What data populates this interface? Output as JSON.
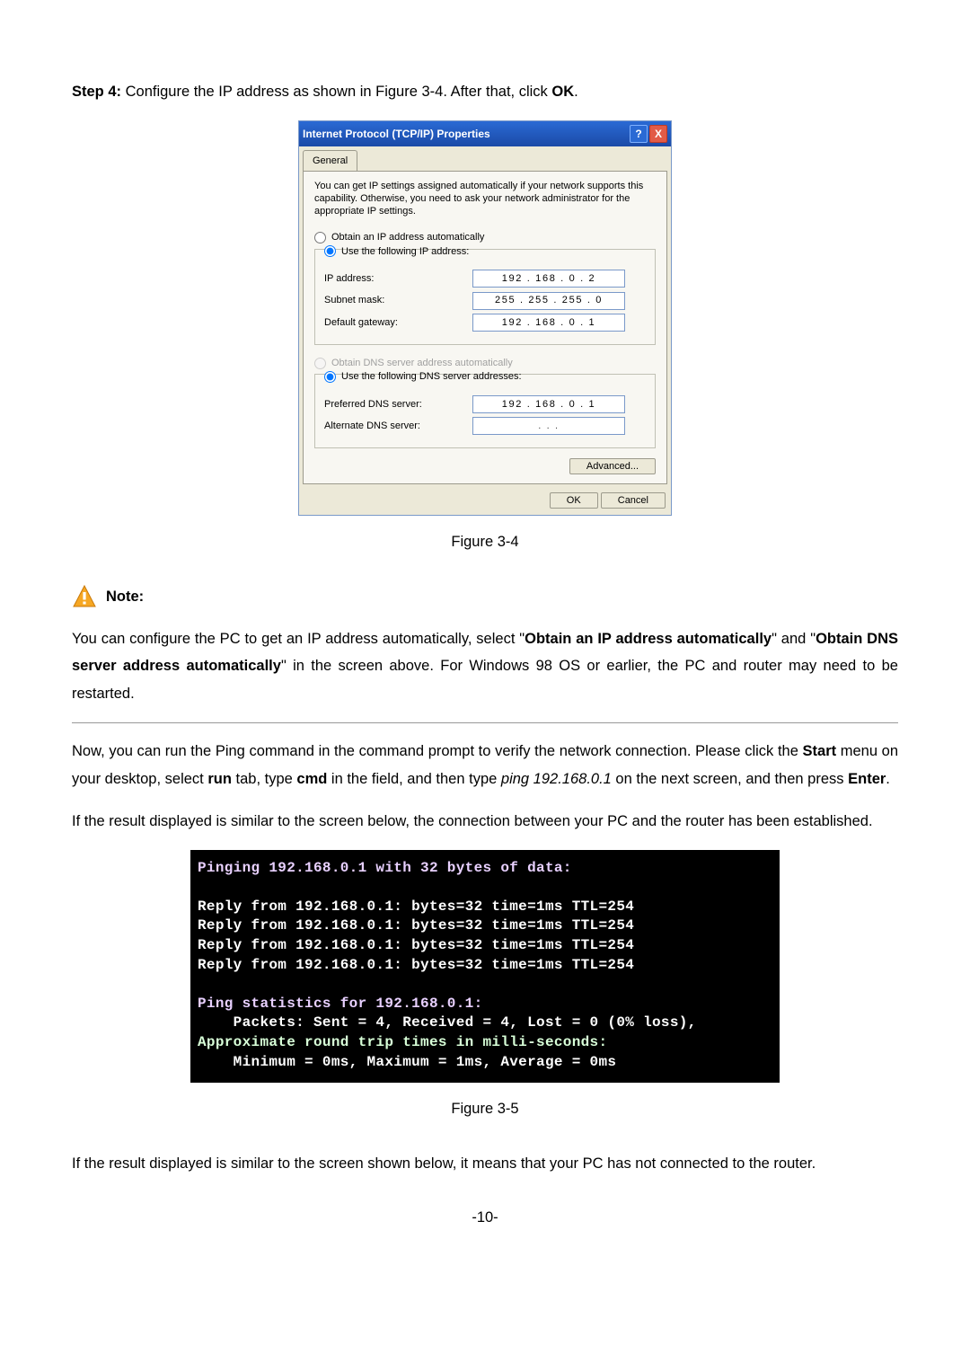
{
  "step": {
    "prefix": "Step 4:",
    "text1": "  Configure the IP address as shown in Figure 3-4. After that, click ",
    "ok": "OK",
    "text2": "."
  },
  "dialog": {
    "title": "Internet Protocol (TCP/IP) Properties",
    "help_glyph": "?",
    "close_glyph": "X",
    "tab_general": "General",
    "desc": "You can get IP settings assigned automatically if your network supports this capability. Otherwise, you need to ask your network administrator for the appropriate IP settings.",
    "radio_ip_auto": "Obtain an IP address automatically",
    "radio_ip_use": "Use the following IP address:",
    "ip_label": "IP address:",
    "ip_value": "192 . 168 .  0  .  2",
    "subnet_label": "Subnet mask:",
    "subnet_value": "255 . 255 . 255 .  0",
    "gateway_label": "Default gateway:",
    "gateway_value": "192 . 168 .  0  .  1",
    "radio_dns_auto": "Obtain DNS server address automatically",
    "radio_dns_use": "Use the following DNS server addresses:",
    "pref_dns_label": "Preferred DNS server:",
    "pref_dns_value": "192 . 168 .  0  .  1",
    "alt_dns_label": "Alternate DNS server:",
    "alt_dns_value": ".       .       .",
    "advanced": "Advanced...",
    "ok": "OK",
    "cancel": "Cancel"
  },
  "fig34": "Figure 3-4",
  "note_label": "Note:",
  "note": {
    "t1": "You can configure the PC to get an IP address automatically, select \"",
    "b1": "Obtain an IP address automatically",
    "t2": "\" and \"",
    "b2": "Obtain DNS server address automatically",
    "t3": "\" in the screen above. For Windows 98 OS or earlier, the PC and router may need to be restarted."
  },
  "para_now": {
    "t1": "Now, you can run the Ping command in the command prompt to verify the network connection. Please click the ",
    "b1": "Start",
    "t2": " menu on your desktop, select ",
    "b2": "run",
    "t3": " tab, type ",
    "b3": "cmd",
    "t4": " in the field, and then type ",
    "i1": "ping 192.168.0.1",
    "t5": " on the next screen, and then press ",
    "b4": "Enter",
    "t6": "."
  },
  "para_ok": "If the result displayed is similar to the screen below, the connection between your PC and the router has been established.",
  "terminal": {
    "l1": "Pinging 192.168.0.1 with 32 bytes of data:",
    "r1": "Reply from 192.168.0.1: bytes=32 time=1ms TTL=254",
    "r2": "Reply from 192.168.0.1: bytes=32 time=1ms TTL=254",
    "r3": "Reply from 192.168.0.1: bytes=32 time=1ms TTL=254",
    "r4": "Reply from 192.168.0.1: bytes=32 time=1ms TTL=254",
    "s1": "Ping statistics for 192.168.0.1:",
    "s2": "    Packets: Sent = 4, Received = 4, Lost = 0 (0% loss),",
    "a1": "Approximate round trip times in milli-seconds:",
    "a2": "    Minimum = 0ms, Maximum = 1ms, Average = 0ms"
  },
  "fig35": "Figure 3-5",
  "para_fail": "If the result displayed is similar to the screen shown below, it means that your PC has not connected to the router.",
  "page_num": "-10-"
}
